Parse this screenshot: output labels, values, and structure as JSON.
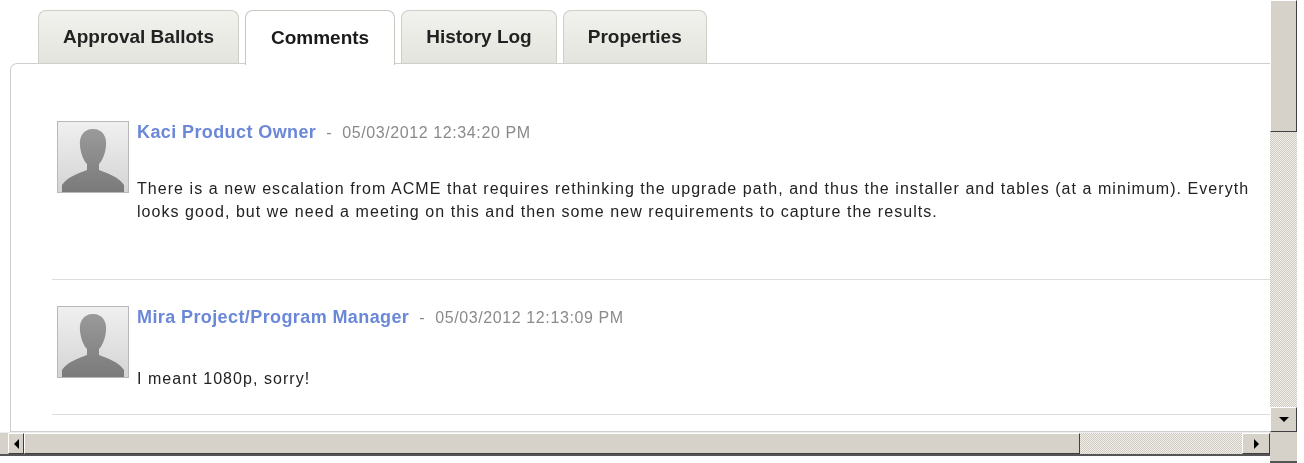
{
  "tabs": [
    {
      "label": "Approval Ballots",
      "selected": false
    },
    {
      "label": "Comments",
      "selected": true
    },
    {
      "label": "History Log",
      "selected": false
    },
    {
      "label": "Properties",
      "selected": false
    }
  ],
  "comments": [
    {
      "author": "Kaci Product Owner",
      "separator": "-",
      "timestamp": "05/03/2012 12:34:20 PM",
      "body_lines": [
        "There is a new escalation from ACME that requires rethinking the upgrade path, and thus the installer and tables (at a minimum). Everyth",
        "looks good, but we need a meeting on this and then some new requirements to capture the results."
      ]
    },
    {
      "author": "Mira Project/Program Manager",
      "separator": "-",
      "timestamp": "05/03/2012 12:13:09 PM",
      "body_lines": [
        "I meant 1080p, sorry!"
      ]
    }
  ]
}
